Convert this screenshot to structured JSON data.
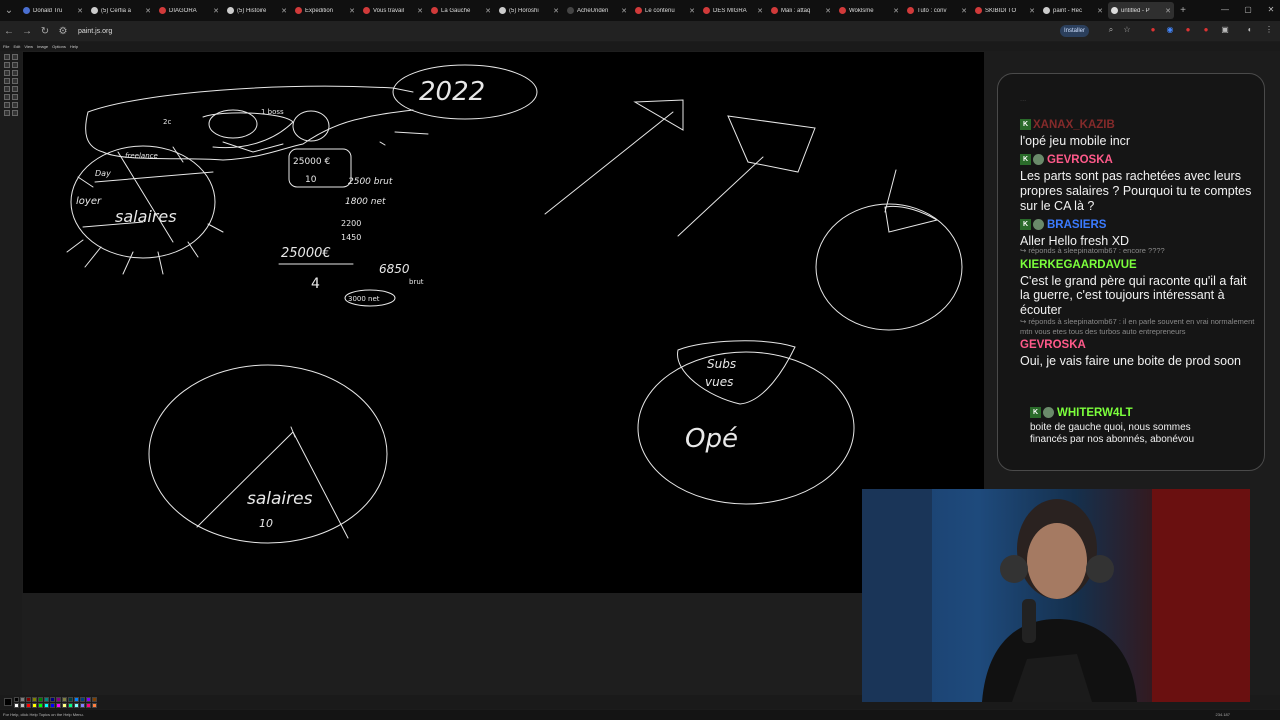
{
  "tabs": [
    {
      "label": "Donald Tru",
      "color": "#4a6fd1"
    },
    {
      "label": "(5) Cerfia a",
      "color": "#cccccc"
    },
    {
      "label": "DIAGORA",
      "color": "#d13a3a"
    },
    {
      "label": "(5) Histoire",
      "color": "#cccccc"
    },
    {
      "label": "Expedition",
      "color": "#d13a3a"
    },
    {
      "label": "Vous travail",
      "color": "#d13a3a"
    },
    {
      "label": "La Gauche",
      "color": "#d13a3a"
    },
    {
      "label": "(5) Horoshi",
      "color": "#cccccc"
    },
    {
      "label": "AcheUnden",
      "color": "#444444"
    },
    {
      "label": "Le contenu",
      "color": "#d13a3a"
    },
    {
      "label": "DES MIGRA",
      "color": "#d13a3a"
    },
    {
      "label": "Mali : attaq",
      "color": "#d13a3a"
    },
    {
      "label": "Woklsme",
      "color": "#d13a3a"
    },
    {
      "label": "Tuto : conv",
      "color": "#d13a3a"
    },
    {
      "label": "SKIBIDI TO",
      "color": "#d13a3a"
    },
    {
      "label": "paint - Rec",
      "color": "#cccccc"
    },
    {
      "label": "untitled - P",
      "color": "#dddddd",
      "active": true
    }
  ],
  "address": {
    "url": "paint.js.org",
    "install_label": "Installer"
  },
  "menu": [
    "File",
    "Edit",
    "View",
    "Image",
    "Options",
    "Help"
  ],
  "canvas_text": {
    "year": "2022",
    "salaires": "salaires",
    "loyer": "loyer",
    "day": "Day",
    "freelance": "freelance",
    "n2": "2c",
    "one_boss": "1 boss",
    "num1": "25000 €",
    "num1b": "10",
    "net1": "2500 brut",
    "net2": "1800 net",
    "n2200": "2200",
    "n1450": "1450",
    "frac_top": "25000€",
    "frac_bot": "4",
    "n6850": "6850",
    "brut": "brut",
    "n3000": "3000 net",
    "salaires2": "salaires",
    "ten": "10",
    "subs": "Subs",
    "viewers": "vues",
    "ope": "Opé"
  },
  "chat": {
    "faded_top": "...",
    "messages": [
      {
        "user": "XANAX_KAZIB",
        "color": "#e03c3c",
        "text": "l'opé jeu mobile incr",
        "badges": [
          "K"
        ]
      },
      {
        "user": "GEVROSKA",
        "color": "#ff5a8a",
        "text": "Les parts sont pas rachetées avec leurs propres salaires ? Pourquoi tu te comptes sur le CA là ?",
        "badges": [
          "K",
          "skull"
        ]
      },
      {
        "user": "BRASIERS",
        "color": "#3b7bff",
        "text": "Aller Hello fresh XD",
        "badges": [
          "K",
          "skull"
        ]
      },
      {
        "reply": "↪ réponds à sleepinatomb67 : encore ????",
        "user": "KIERKEGAARDAVUE",
        "color": "#7cff3c",
        "text": "C'est le grand père qui raconte qu'il a fait la guerre, c'est toujours intéressant à écouter"
      },
      {
        "reply": "↪ réponds à sleepinatomb67 : il en parle souvent en vrai normalement mtn vous etes tous des turbos auto entrepreneurs",
        "user": "GEVROSKA",
        "color": "#ff5a8a",
        "text": "Oui, je vais faire une boite de prod soon"
      },
      {
        "user": "WHITERW4LT",
        "color": "#7cff3c",
        "text": "boite de gauche quoi, nous sommes financés par nos abonnés, abonévou",
        "badges": [
          "K",
          "skull"
        ]
      }
    ]
  },
  "status": {
    "help": "For Help, click Help Topics on the Help Menu.",
    "coords": "234.187"
  },
  "palette_colors": [
    "#000000",
    "#808080",
    "#800000",
    "#808000",
    "#008000",
    "#008080",
    "#000080",
    "#800080",
    "#808040",
    "#004040",
    "#0080ff",
    "#004080",
    "#8000ff",
    "#804000",
    "#ffffff",
    "#c0c0c0",
    "#ff0000",
    "#ffff00",
    "#00ff00",
    "#00ffff",
    "#0000ff",
    "#ff00ff",
    "#ffff80",
    "#00ff80",
    "#80ffff",
    "#8080ff",
    "#ff0080",
    "#ff8040"
  ]
}
